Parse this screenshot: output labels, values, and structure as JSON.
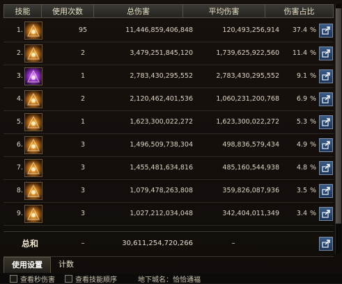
{
  "header": {
    "skill": "技能",
    "count": "使用次数",
    "total": "总伤害",
    "avg": "平均伤害",
    "pct": "伤害占比"
  },
  "rows": [
    {
      "no": "1.",
      "count": "95",
      "total": "11,446,859,406,848",
      "avg": "120,493,256,914",
      "pct": "37.4",
      "unit": "%",
      "icon": "skill-icon"
    },
    {
      "no": "2.",
      "count": "2",
      "total": "3,479,251,845,120",
      "avg": "1,739,625,922,560",
      "pct": "11.4",
      "unit": "%",
      "icon": "skill-icon"
    },
    {
      "no": "3.",
      "count": "1",
      "total": "2,783,430,295,552",
      "avg": "2,783,430,295,552",
      "pct": "9.1",
      "unit": "%",
      "icon": "skill-icon"
    },
    {
      "no": "4.",
      "count": "2",
      "total": "2,120,462,401,536",
      "avg": "1,060,231,200,768",
      "pct": "6.9",
      "unit": "%",
      "icon": "skill-icon"
    },
    {
      "no": "5.",
      "count": "1",
      "total": "1,623,300,022,272",
      "avg": "1,623,300,022,272",
      "pct": "5.3",
      "unit": "%",
      "icon": "skill-icon"
    },
    {
      "no": "6.",
      "count": "3",
      "total": "1,496,509,738,304",
      "avg": "498,836,579,434",
      "pct": "4.9",
      "unit": "%",
      "icon": "skill-icon"
    },
    {
      "no": "7.",
      "count": "3",
      "total": "1,455,481,634,816",
      "avg": "485,160,544,938",
      "pct": "4.8",
      "unit": "%",
      "icon": "skill-icon"
    },
    {
      "no": "8.",
      "count": "3",
      "total": "1,079,478,263,808",
      "avg": "359,826,087,936",
      "pct": "3.5",
      "unit": "%",
      "icon": "skill-icon"
    },
    {
      "no": "9.",
      "count": "3",
      "total": "1,027,212,034,048",
      "avg": "342,404,011,349",
      "pct": "3.4",
      "unit": "%",
      "icon": "skill-icon"
    }
  ],
  "summary": {
    "label": "总和",
    "count": "–",
    "total": "30,611,254,720,266",
    "avg": "–"
  },
  "tabs": {
    "settings": "使用设置",
    "count": "计数"
  },
  "bottom": {
    "check1": "查看秒伤害",
    "check2": "查看技能顺序",
    "dungeon": "地下城名：恰恰通福"
  },
  "colors": {
    "accent_blue": "#2a4c7a",
    "text": "#e4ddcc"
  }
}
